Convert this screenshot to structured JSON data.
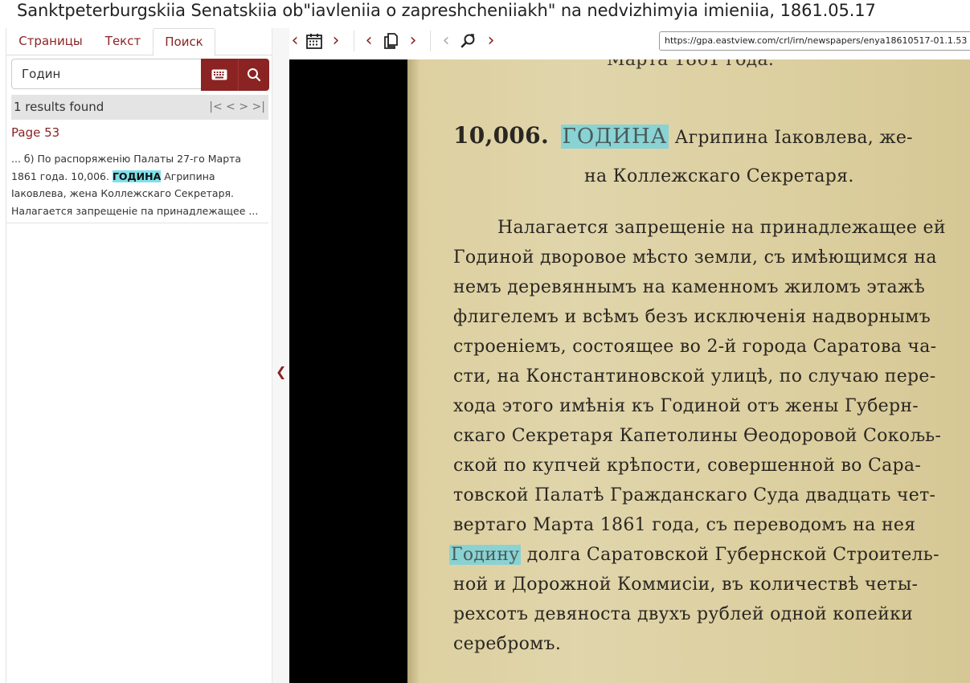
{
  "window": {
    "title": "Sanktpeterburgskiia Senatskiia ob\"iavleniia o zapreshcheniiakh\" na nedvizhimyia imieniia, 1861.05.17"
  },
  "tabs": [
    {
      "label": "Страницы"
    },
    {
      "label": "Текст"
    },
    {
      "label": "Поиск"
    }
  ],
  "search": {
    "value": "Годин",
    "results_text": "1 results found",
    "pager": {
      "first": "|<",
      "prev": "<",
      "next": ">",
      "last": ">|"
    }
  },
  "result": {
    "page_label": "Page 53",
    "snippet_before": "... б) По распоряженiю Палаты 27-го Марта 1861 года. 10,006. ",
    "snippet_highlight": "ГОДИНА",
    "snippet_after": " Агрипина Iаковлева, жена Коллежскаго Секретаря. Налагается запрещенiе па принадлежащее ..."
  },
  "toolbar": {
    "url": "https://gpa.eastview.com/crl/irn/newspapers/enya18610517-01.1.53"
  },
  "document": {
    "ghost_top": "Марта 1861 года.",
    "entry_number": "10,006.",
    "heading_hit": "ГОДИНА",
    "heading_rest": " Агрипина Iаковлева, же-",
    "heading_line2": "на Коллежскаго Секретаря.",
    "lines": [
      "Налагается запрещенiе на принадлежащее ей",
      "Годиной  дворовое мѣсто земли, съ имѣющимся на",
      "немъ деревяннымъ на каменномъ жиломъ  этажѣ",
      "флигелемъ и всѣмъ безъ  исключенiя   надворнымъ",
      "строенiемъ, состоящее во 2-й города Саратова ча-",
      "сти, на Константиновской улицѣ, по случаю пере-",
      "хода этого имѣнiя къ Годиной отъ жены Губерн-",
      "скаго Секретаря Капетолины Ѳеодоровой Сокољь-",
      "ской по купчей крѣпости, совершенной во Сара-",
      "товской Палатѣ Гражданскаго Суда двадцать чет-",
      "вертаго Марта 1861 года, съ переводомъ на нея"
    ],
    "line_hit": "Годину",
    "line_hit_rest": " долга Саратовской Губернской Строитель-",
    "lines_after": [
      "ной и Дорожной Коммисiи, въ количествѣ четы-",
      "рехсотъ девяноста двухъ рублей одной  копейки",
      "серебромъ."
    ]
  },
  "colors": {
    "accent": "#8b2323",
    "highlight": "#7fe0ec"
  }
}
